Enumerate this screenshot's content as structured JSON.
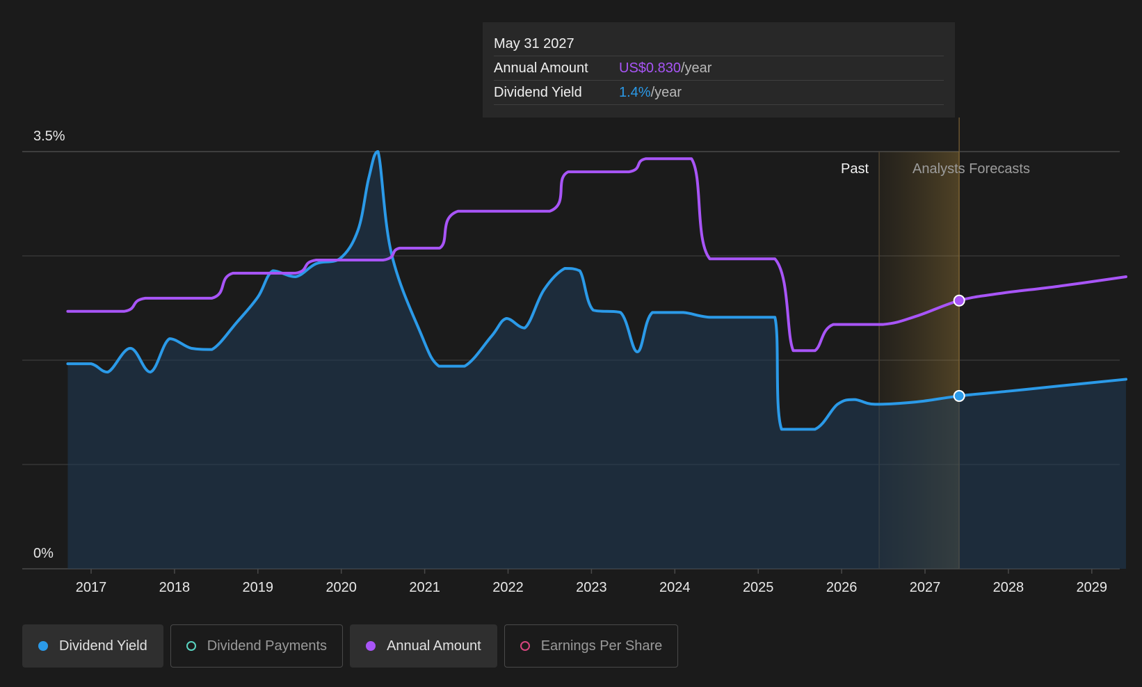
{
  "tooltip": {
    "date": "May 31 2027",
    "rows": [
      {
        "label": "Annual Amount",
        "value": "US$0.830",
        "unit": "/year",
        "color": "#a855f7"
      },
      {
        "label": "Dividend Yield",
        "value": "1.4%",
        "unit": "/year",
        "color": "#2b9ae8"
      }
    ]
  },
  "legend": [
    {
      "label": "Dividend Yield",
      "active": true,
      "color": "#2b9ae8",
      "hollow": false
    },
    {
      "label": "Dividend Payments",
      "active": false,
      "color": "#59d3c0",
      "hollow": true
    },
    {
      "label": "Annual Amount",
      "active": true,
      "color": "#a855f7",
      "hollow": false
    },
    {
      "label": "Earnings Per Share",
      "active": false,
      "color": "#d6457f",
      "hollow": true
    }
  ],
  "chart_data": {
    "type": "line",
    "x_ticks": [
      "2017",
      "2018",
      "2019",
      "2020",
      "2021",
      "2022",
      "2023",
      "2024",
      "2025",
      "2026",
      "2027",
      "2028",
      "2029"
    ],
    "y_tick_labels": [
      {
        "value": 3.5,
        "label": "3.5%"
      },
      {
        "value": 0,
        "label": "0%"
      }
    ],
    "ylim": [
      0,
      3.5
    ],
    "xlim": [
      2016.83,
      2029.41
    ],
    "grid": true,
    "past_label": "Past",
    "forecast_label": "Analysts Forecasts",
    "forecast_start": 2026.45,
    "highlight_date": 2027.41,
    "series": [
      {
        "name": "Dividend Yield",
        "color": "#2b9ae8",
        "area": true,
        "points": [
          [
            2016.72,
            1.72
          ],
          [
            2017.0,
            1.72
          ],
          [
            2017.2,
            1.65
          ],
          [
            2017.47,
            1.85
          ],
          [
            2017.71,
            1.65
          ],
          [
            2017.94,
            1.93
          ],
          [
            2018.2,
            1.85
          ],
          [
            2018.45,
            1.84
          ],
          [
            2018.75,
            2.07
          ],
          [
            2019.0,
            2.28
          ],
          [
            2019.18,
            2.5
          ],
          [
            2019.45,
            2.45
          ],
          [
            2019.7,
            2.56
          ],
          [
            2019.98,
            2.6
          ],
          [
            2020.2,
            2.84
          ],
          [
            2020.33,
            3.28
          ],
          [
            2020.44,
            3.5
          ],
          [
            2020.6,
            2.65
          ],
          [
            2020.95,
            1.98
          ],
          [
            2021.17,
            1.7
          ],
          [
            2021.48,
            1.7
          ],
          [
            2021.8,
            1.95
          ],
          [
            2021.98,
            2.1
          ],
          [
            2022.2,
            2.02
          ],
          [
            2022.43,
            2.34
          ],
          [
            2022.68,
            2.52
          ],
          [
            2022.86,
            2.5
          ],
          [
            2023.02,
            2.17
          ],
          [
            2023.35,
            2.15
          ],
          [
            2023.55,
            1.82
          ],
          [
            2023.73,
            2.15
          ],
          [
            2024.1,
            2.15
          ],
          [
            2024.42,
            2.11
          ],
          [
            2024.95,
            2.11
          ],
          [
            2025.2,
            2.11
          ],
          [
            2025.28,
            1.17
          ],
          [
            2025.68,
            1.17
          ],
          [
            2025.95,
            1.38
          ],
          [
            2026.15,
            1.42
          ],
          [
            2026.4,
            1.38
          ],
          [
            2026.9,
            1.4
          ],
          [
            2027.41,
            1.45
          ],
          [
            2028.0,
            1.49
          ],
          [
            2028.7,
            1.54
          ],
          [
            2029.41,
            1.59
          ]
        ]
      },
      {
        "name": "Annual Amount",
        "color": "#a855f7",
        "area": false,
        "points": [
          [
            2016.72,
            2.16
          ],
          [
            2017.4,
            2.16
          ],
          [
            2017.65,
            2.27
          ],
          [
            2018.45,
            2.27
          ],
          [
            2018.7,
            2.48
          ],
          [
            2019.45,
            2.48
          ],
          [
            2019.7,
            2.59
          ],
          [
            2020.5,
            2.59
          ],
          [
            2020.7,
            2.69
          ],
          [
            2021.18,
            2.69
          ],
          [
            2021.4,
            3.0
          ],
          [
            2022.5,
            3.0
          ],
          [
            2022.72,
            3.33
          ],
          [
            2023.45,
            3.33
          ],
          [
            2023.65,
            3.44
          ],
          [
            2024.2,
            3.44
          ],
          [
            2024.42,
            2.6
          ],
          [
            2025.2,
            2.6
          ],
          [
            2025.42,
            1.83
          ],
          [
            2025.68,
            1.83
          ],
          [
            2025.9,
            2.05
          ],
          [
            2026.5,
            2.05
          ],
          [
            2026.9,
            2.12
          ],
          [
            2027.41,
            2.25
          ],
          [
            2027.9,
            2.31
          ],
          [
            2028.6,
            2.37
          ],
          [
            2029.41,
            2.45
          ]
        ]
      }
    ]
  }
}
